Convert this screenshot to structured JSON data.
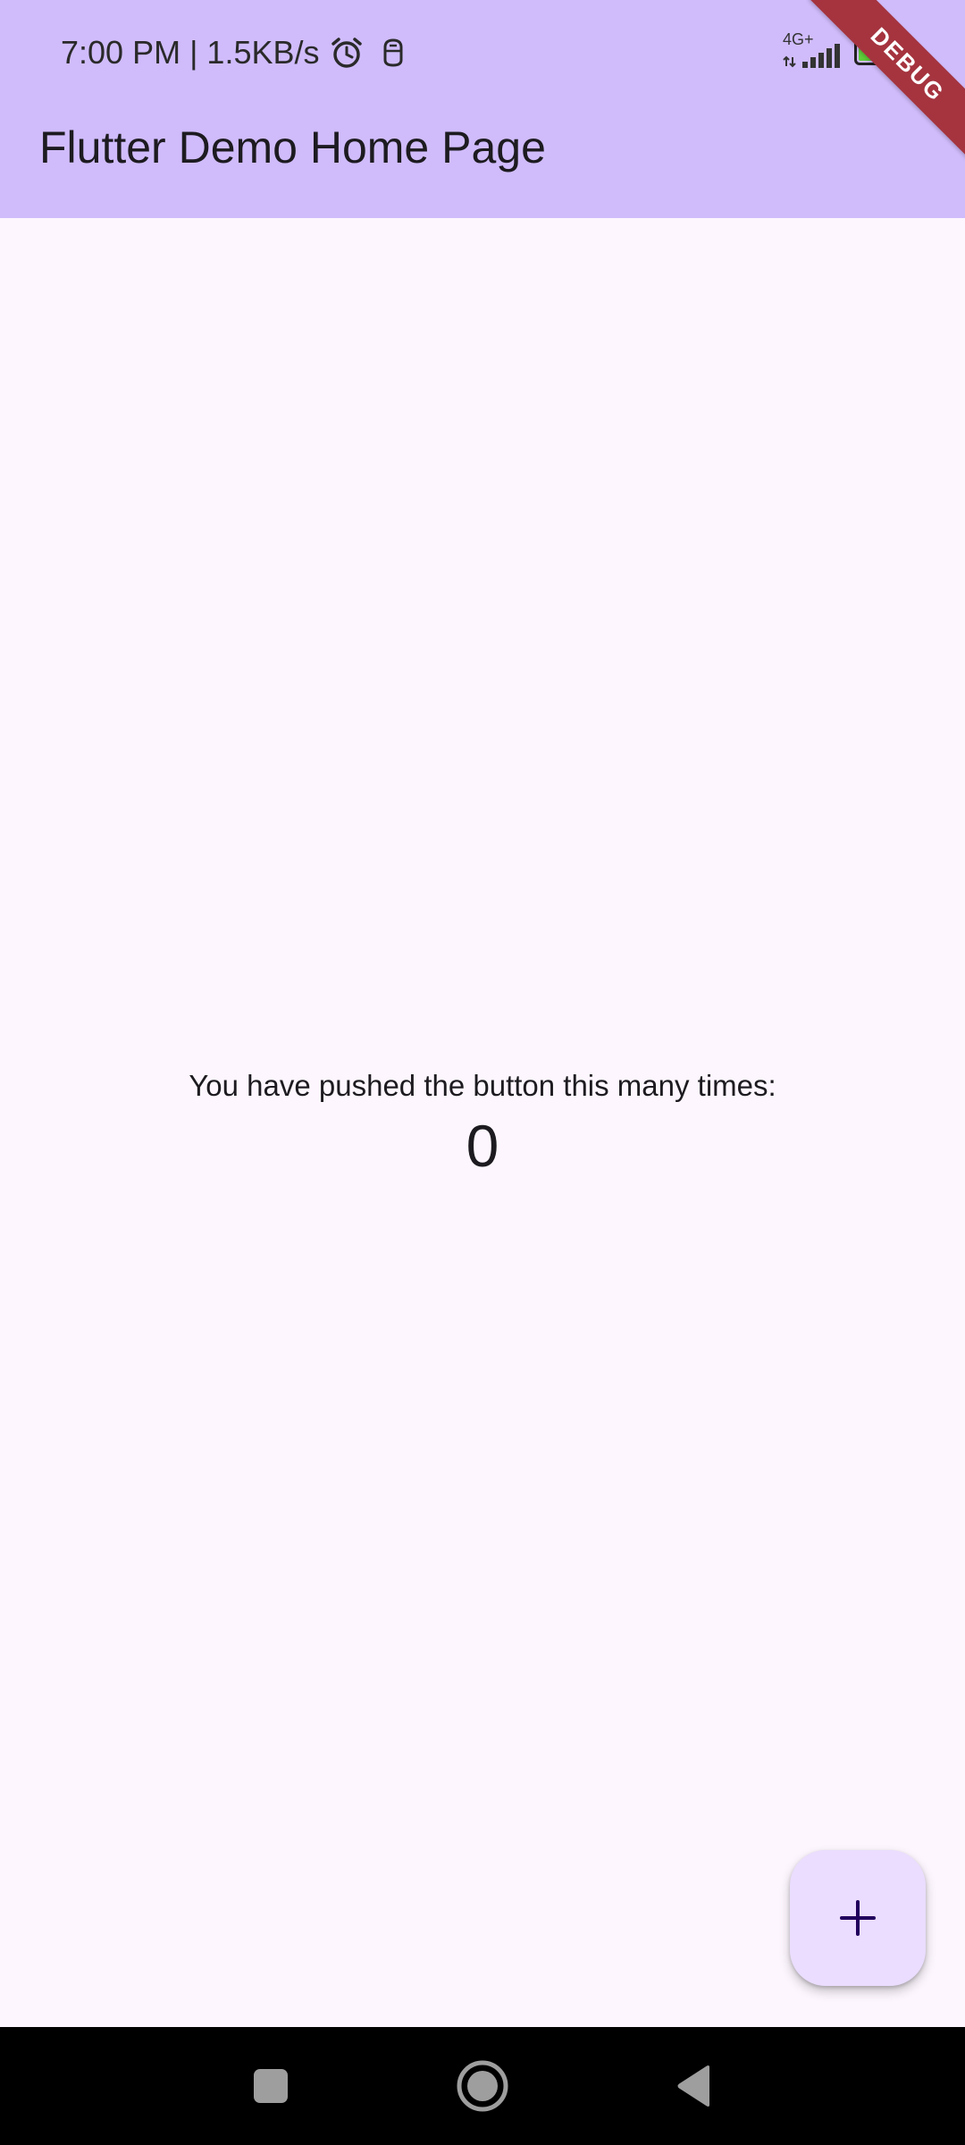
{
  "status_bar": {
    "time_speed": "7:00 PM | 1.5KB/s",
    "network_type": "4G+",
    "battery_level": "60",
    "battery_fraction": 0.6,
    "icons": [
      "alarm-icon",
      "notification-app-icon",
      "signal-icon",
      "battery-icon"
    ]
  },
  "app_bar": {
    "title": "Flutter Demo Home Page",
    "debug_banner": "DEBUG"
  },
  "main": {
    "counter_label": "You have pushed the button this many times:",
    "counter_value": "0"
  },
  "fab": {
    "icon": "plus-icon"
  },
  "nav_bar": {
    "buttons": [
      "recents-square-icon",
      "home-circle-icon",
      "back-triangle-icon"
    ]
  },
  "colors": {
    "app_bar_bg": "#d0bcfb",
    "page_bg": "#fdf6fe",
    "fab_bg": "#eaddff",
    "debug_banner": "#a5343f",
    "nav_bar_bg": "#000000"
  }
}
